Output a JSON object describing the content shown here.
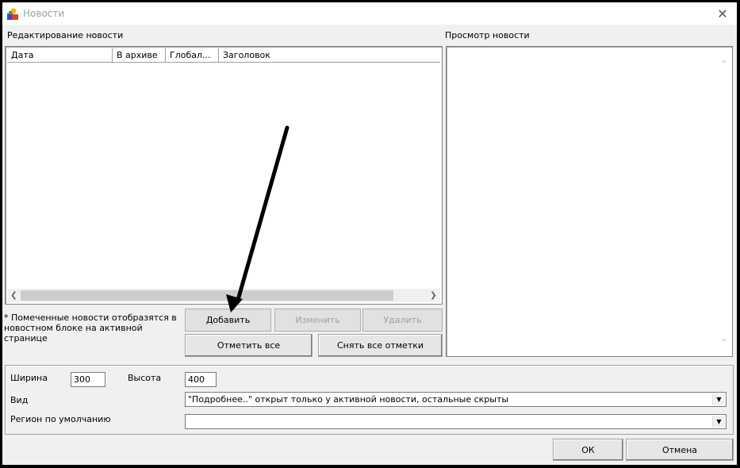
{
  "window": {
    "title": "Новости"
  },
  "left_panel": {
    "title": "Редактирование новости",
    "columns": [
      "Дата",
      "В архиве",
      "Глобал...",
      "Заголовок"
    ]
  },
  "right_panel": {
    "title": "Просмотр новости"
  },
  "note": "* Помеченные новости отобразятся в новостном блоке на активной странице",
  "buttons": {
    "add": "Добавить",
    "edit": "Изменить",
    "delete": "Удалить",
    "mark_all": "Отметить все",
    "unmark_all": "Снять все отметки",
    "ok": "ОК",
    "cancel": "Отмена"
  },
  "settings": {
    "width_label": "Ширина",
    "width_value": "300",
    "height_label": "Высота",
    "height_value": "400",
    "view_label": "Вид",
    "view_value": "\"Подробнее..\" открыт только у активной новости, остальные скрыты",
    "region_label": "Регион по умолчанию",
    "region_value": ""
  },
  "icons": {
    "app": "news-app-icon",
    "close": "close-icon",
    "scroll_left": "chevron-left-icon",
    "scroll_right": "chevron-right-icon",
    "scroll_up": "chevron-up-icon",
    "scroll_down": "chevron-down-icon",
    "dropdown": "dropdown-arrow-icon",
    "annotation": "arrow-annotation"
  }
}
